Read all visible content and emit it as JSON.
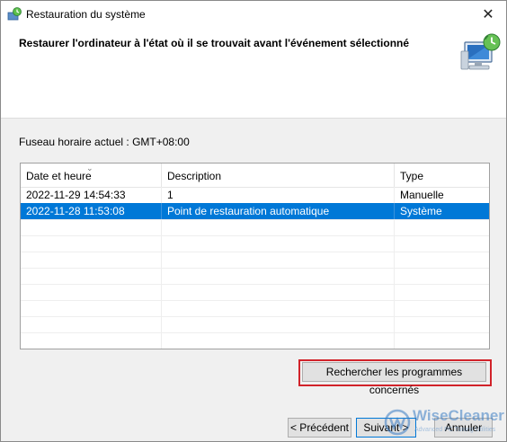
{
  "window": {
    "title": "Restauration du système",
    "heading": "Restaurer l'ordinateur à l'état où il se trouvait avant l'événement sélectionné",
    "close_glyph": "✕"
  },
  "timezone_text": "Fuseau horaire actuel : GMT+08:00",
  "table": {
    "columns": [
      "Date et heure",
      "Description",
      "Type"
    ],
    "sorted_column": "Date et heure",
    "rows": [
      {
        "date": "2022-11-29 14:54:33",
        "description": "1",
        "type": "Manuelle",
        "selected": false
      },
      {
        "date": "2022-11-28 11:53:08",
        "description": "Point de restauration automatique",
        "type": "Système",
        "selected": true
      }
    ]
  },
  "buttons": {
    "scan": "Rechercher les programmes concernés",
    "back": "< Précédent",
    "next": "Suivant >",
    "cancel": "Annuler"
  },
  "watermark": {
    "brand": "WiseCleaner",
    "tagline": "Advanced PC Tuning Utilities"
  },
  "colors": {
    "selection": "#0078d7",
    "highlight_box": "#d1232a",
    "primary_border": "#0078d7"
  },
  "icons": {
    "title": "system-restore-icon",
    "header": "computer-restore-icon",
    "close": "close-icon",
    "sort": "sort-arrow-icon",
    "watermark": "wisecleaner-logo-icon"
  }
}
